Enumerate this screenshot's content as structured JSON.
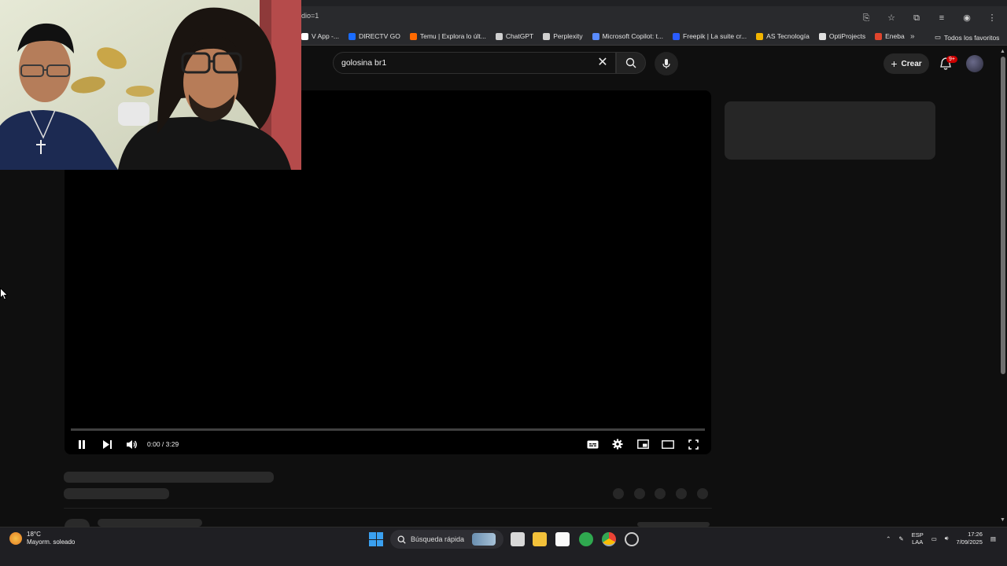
{
  "browser": {
    "url_fragment": "dio=1",
    "bookmarks": [
      {
        "label": "V App -...",
        "color": "#ffffff"
      },
      {
        "label": "DIRECTV GO",
        "color": "#1a6cff"
      },
      {
        "label": "Temu | Explora lo últ...",
        "color": "#ff6a00"
      },
      {
        "label": "ChatGPT",
        "color": "#cfcfcf"
      },
      {
        "label": "Perplexity",
        "color": "#cfcfcf"
      },
      {
        "label": "Microsoft Copilot: t...",
        "color": "#5a8cff"
      },
      {
        "label": "Freepik | La suite cr...",
        "color": "#2a5cff"
      },
      {
        "label": "AS Tecnología",
        "color": "#f2b400"
      },
      {
        "label": "OptiProjects",
        "color": "#e0e0e0"
      },
      {
        "label": "Eneba",
        "color": "#e0452d"
      }
    ],
    "bookmarks_more": "»",
    "all_bookmarks": "Todos los favoritos"
  },
  "youtube": {
    "search_query": "golosina br1",
    "create_label": "Crear",
    "notification_badge": "9+"
  },
  "player": {
    "time_display": "0:00 / 3:29",
    "progress": 0.0
  },
  "taskbar": {
    "temperature": "18°C",
    "weather_desc": "Mayorm. soleado",
    "search_label": "Búsqueda rápida",
    "lang_top": "ESP",
    "lang_bottom": "LAA",
    "time": "17:26",
    "date": "7/09/2025"
  },
  "colors": {
    "page_bg": "#0f0f0f",
    "player_bg": "#000000",
    "accent_red": "#ff0000"
  }
}
